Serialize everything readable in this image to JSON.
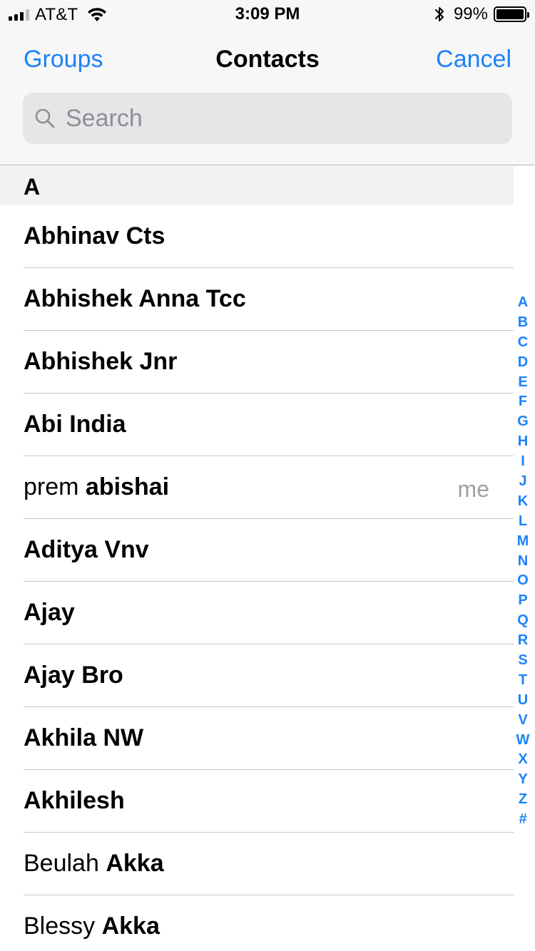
{
  "status_bar": {
    "carrier": "AT&T",
    "time": "3:09 PM",
    "battery_percent": "99%",
    "battery_level": 0.99,
    "signal_bars_filled": 3,
    "signal_bars_total": 4,
    "icons": [
      "signal-icon",
      "wifi-icon",
      "bluetooth-icon",
      "battery-icon"
    ]
  },
  "nav": {
    "left_label": "Groups",
    "title": "Contacts",
    "right_label": "Cancel"
  },
  "search": {
    "placeholder": "Search"
  },
  "section": {
    "letter": "A"
  },
  "contacts": [
    {
      "first": "Abhinav Cts",
      "last": "",
      "badge": ""
    },
    {
      "first": "Abhishek Anna Tcc",
      "last": "",
      "badge": ""
    },
    {
      "first": "Abhishek Jnr",
      "last": "",
      "badge": ""
    },
    {
      "first": "Abi India",
      "last": "",
      "badge": ""
    },
    {
      "first": "prem ",
      "last": "abishai",
      "badge": "me"
    },
    {
      "first": "Aditya Vnv",
      "last": "",
      "badge": ""
    },
    {
      "first": "Ajay",
      "last": "",
      "badge": ""
    },
    {
      "first": "Ajay Bro",
      "last": "",
      "badge": ""
    },
    {
      "first": "Akhila NW",
      "last": "",
      "badge": ""
    },
    {
      "first": "Akhilesh",
      "last": "",
      "badge": ""
    },
    {
      "first": "Beulah ",
      "last": "Akka",
      "badge": ""
    },
    {
      "first": "Blessy ",
      "last": "Akka",
      "badge": ""
    }
  ],
  "index_letters": [
    "A",
    "B",
    "C",
    "D",
    "E",
    "F",
    "G",
    "H",
    "I",
    "J",
    "K",
    "L",
    "M",
    "N",
    "O",
    "P",
    "Q",
    "R",
    "S",
    "T",
    "U",
    "V",
    "W",
    "X",
    "Y",
    "Z",
    "#"
  ],
  "colors": {
    "accent": "#1a82fb",
    "bar_background": "#f7f7f7",
    "section_background": "#f2f2f2",
    "secondary_text": "#a0a0a5"
  }
}
